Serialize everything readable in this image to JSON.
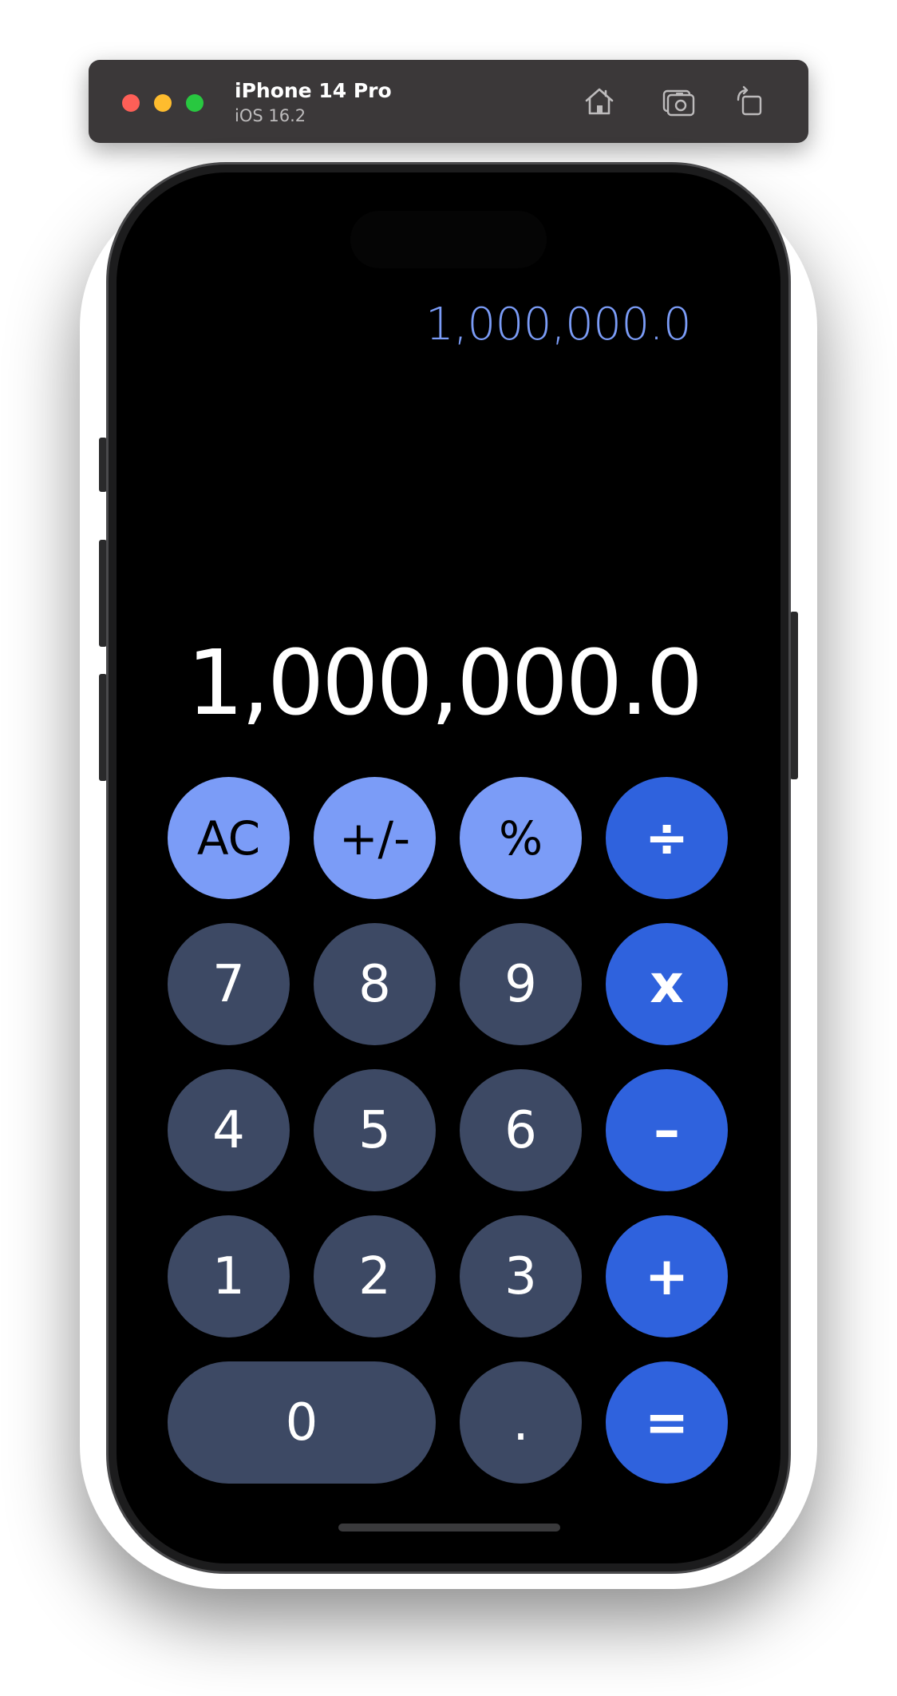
{
  "simulator": {
    "device_name": "iPhone 14 Pro",
    "os_version": "iOS 16.2",
    "icons": [
      "home-icon",
      "screenshot-icon",
      "rotate-icon"
    ]
  },
  "calculator": {
    "history_value": "1,000,000.0",
    "display_value": "1,000,000.0",
    "keys": {
      "ac": "AC",
      "plus_minus": "+/-",
      "percent": "%",
      "divide": "÷",
      "seven": "7",
      "eight": "8",
      "nine": "9",
      "multiply": "x",
      "four": "4",
      "five": "5",
      "six": "6",
      "minus": "–",
      "one": "1",
      "two": "2",
      "three": "3",
      "plus": "+",
      "zero": "0",
      "decimal": ".",
      "equals": "="
    },
    "colors": {
      "function_key": "#7b9cf7",
      "number_key": "#3d4964",
      "operator_key": "#2f62dd",
      "history_text": "#7b9cf7",
      "background": "#000000"
    }
  }
}
